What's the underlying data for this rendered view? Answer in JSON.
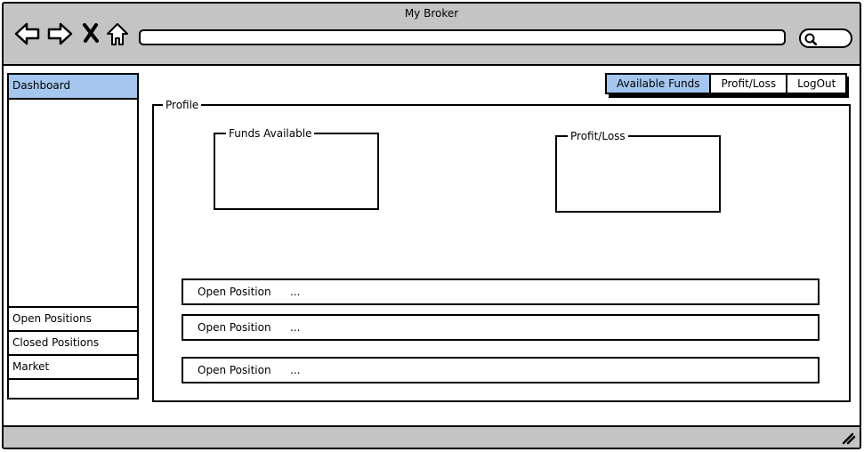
{
  "window": {
    "title": "My Broker"
  },
  "sidebar": {
    "items": [
      {
        "label": "Dashboard"
      },
      {
        "label": "Open Positions"
      },
      {
        "label": "Closed Positions"
      },
      {
        "label": "Market"
      }
    ]
  },
  "tabs": [
    {
      "label": "Available Funds"
    },
    {
      "label": "Profit/Loss"
    },
    {
      "label": "LogOut"
    }
  ],
  "profile": {
    "legend": "Profile",
    "funds_box": {
      "legend": "Funds Available"
    },
    "pl_box": {
      "legend": "Profit/Loss"
    },
    "positions": [
      {
        "label": "Open Position",
        "value": "..."
      },
      {
        "label": "Open Position",
        "value": "..."
      },
      {
        "label": "Open Position",
        "value": "..."
      }
    ]
  },
  "colors": {
    "chrome": "#c4c4c4",
    "accent": "#a5c6ee"
  },
  "icons": [
    "back-arrow-icon",
    "forward-arrow-icon",
    "close-x-icon",
    "home-icon",
    "search-icon",
    "resize-grip-icon"
  ]
}
